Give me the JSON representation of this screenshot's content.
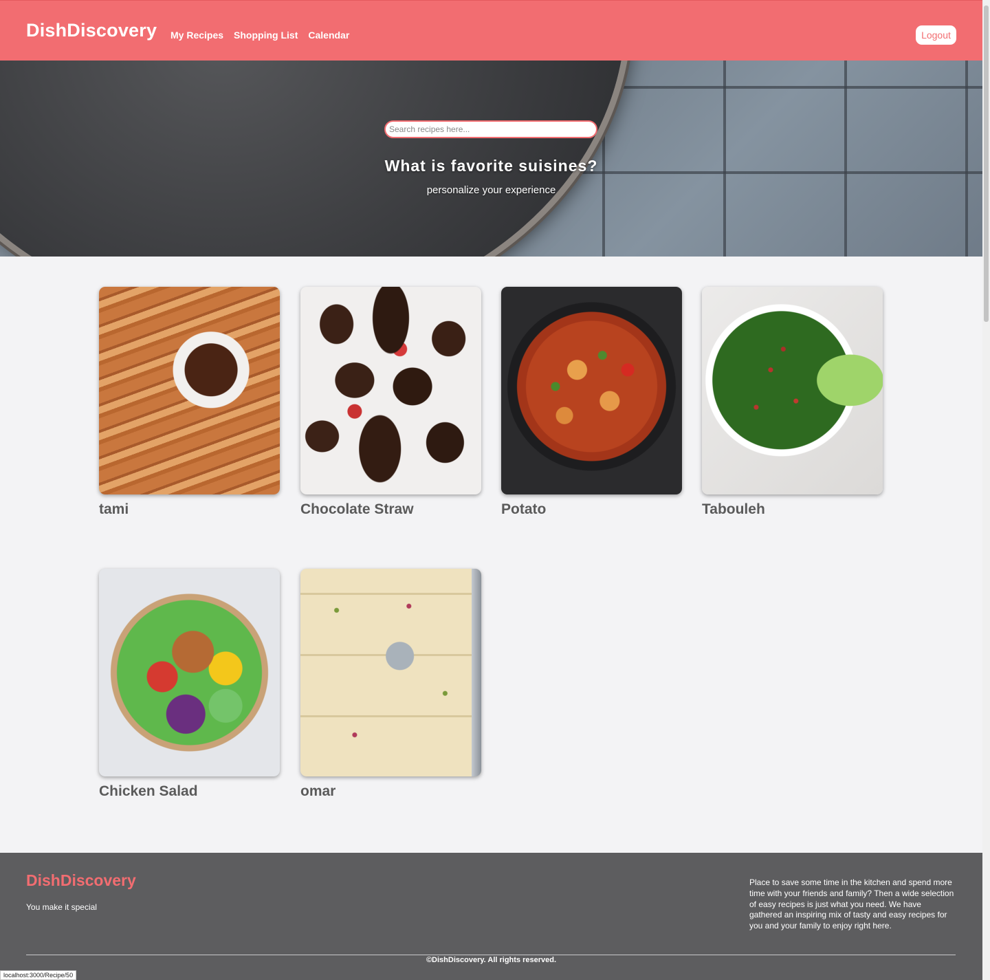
{
  "navbar": {
    "brand": "DishDiscovery",
    "links": [
      "My Recipes",
      "Shopping List",
      "Calendar"
    ],
    "logout_label": "Logout"
  },
  "hero": {
    "search_placeholder": "Search recipes here...",
    "title": "What is favorite suisines?",
    "subtitle": "personalize your experience"
  },
  "recipes": [
    {
      "title": "tami",
      "image": "churros with chocolate dip"
    },
    {
      "title": "Chocolate Straw",
      "image": "chocolate covered strawberries"
    },
    {
      "title": "Potato",
      "image": "chicken and vegetable stew in skillet"
    },
    {
      "title": "Tabouleh",
      "image": "tabouleh salad with lettuce"
    },
    {
      "title": "Chicken Salad",
      "image": "chicken salad bowl"
    },
    {
      "title": "omar",
      "image": "semolina dessert squares"
    }
  ],
  "footer": {
    "brand": "DishDiscovery",
    "tagline": "You make it special",
    "description": "Place to save some time in the kitchen and spend more time with your friends and family? Then a wide selection of easy recipes is just what you need. We have gathered an inspiring mix of tasty and easy recipes for you and your family to enjoy right here.",
    "copyright": "©DishDiscovery. All rights reserved."
  },
  "status_bar": {
    "url": "localhost:3000/Recipe/50"
  },
  "colors": {
    "accent": "#f26d71",
    "footer_bg": "#5d5d5f",
    "page_bg": "#f3f3f5"
  }
}
